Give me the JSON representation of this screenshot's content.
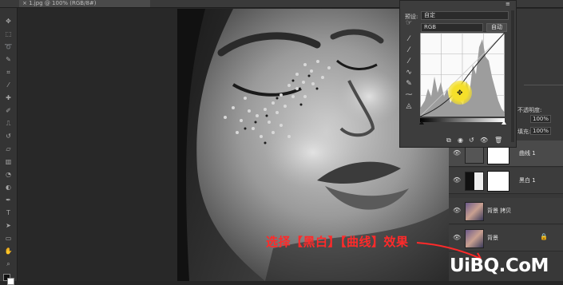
{
  "document": {
    "tab_title": "× 1.jpg @ 100% (RGB/8#)"
  },
  "properties_panel": {
    "preset_label": "预设:",
    "preset_value": "自定",
    "channel_value": "RGB",
    "auto_label": "自动"
  },
  "layers_panel": {
    "opacity_label": "不透明度:",
    "opacity_value": "100%",
    "fill_label": "填充:",
    "fill_value": "100%",
    "layers": [
      {
        "name": "曲线 1",
        "kind": "adjustment-curves",
        "selected": true
      },
      {
        "name": "黑白 1",
        "kind": "adjustment-bw",
        "selected": false
      },
      {
        "name": "背景 拷贝",
        "kind": "pixel",
        "selected": false
      },
      {
        "name": "背景",
        "kind": "background",
        "selected": false
      }
    ]
  },
  "caption": "选择【黑白】【曲线】效果",
  "watermark": "UiBQ.CoM",
  "colors": {
    "caption": "#ff2a2a",
    "highlight": "#f5e02a"
  }
}
